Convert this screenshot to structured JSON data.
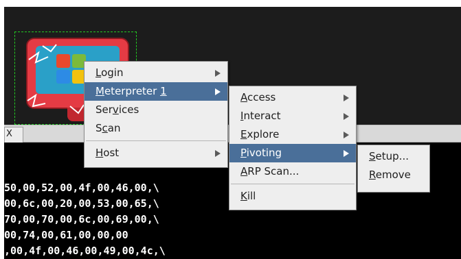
{
  "console": {
    "tab_label": "X",
    "lines": [
      "50,00,52,00,4f,00,46,00,\\",
      "00,6c,00,20,00,53,00,65,\\",
      "70,00,70,00,6c,00,69,00,\\",
      "00,74,00,61,00,00,00",
      ",00,4f,00,46,00,49,00,4c,\\"
    ]
  },
  "host": {
    "icon": "windows-host-icon"
  },
  "menu1": {
    "items": [
      {
        "pre": "",
        "mn": "L",
        "post": "ogin",
        "has_sub": true
      },
      {
        "pre": "",
        "mn": "M",
        "post": "eterpreter ",
        "suffix": "1",
        "has_sub": true,
        "selected": true
      },
      {
        "pre": "Ser",
        "mn": "v",
        "post": "ices",
        "has_sub": false
      },
      {
        "pre": "S",
        "mn": "c",
        "post": "an",
        "has_sub": false
      },
      {
        "pre": "",
        "mn": "H",
        "post": "ost",
        "has_sub": true
      }
    ]
  },
  "menu2": {
    "items": [
      {
        "pre": "",
        "mn": "A",
        "post": "ccess",
        "has_sub": true
      },
      {
        "pre": "",
        "mn": "I",
        "post": "nteract",
        "has_sub": true
      },
      {
        "pre": "",
        "mn": "E",
        "post": "xplore",
        "has_sub": true
      },
      {
        "pre": "",
        "mn": "P",
        "post": "ivoting",
        "has_sub": true,
        "selected": true
      },
      {
        "pre": "",
        "mn": "A",
        "post": "RP Scan...",
        "has_sub": false
      },
      {
        "pre": "",
        "mn": "K",
        "post": "ill",
        "has_sub": false
      }
    ]
  },
  "menu3": {
    "items": [
      {
        "pre": "",
        "mn": "S",
        "post": "etup...",
        "has_sub": false
      },
      {
        "pre": "",
        "mn": "R",
        "post": "emove",
        "has_sub": false
      }
    ]
  },
  "colors": {
    "selection": "#4a6f99",
    "console_bg": "#000000",
    "graph_bg": "#1c1c1c",
    "host_border": "#22cc22"
  }
}
